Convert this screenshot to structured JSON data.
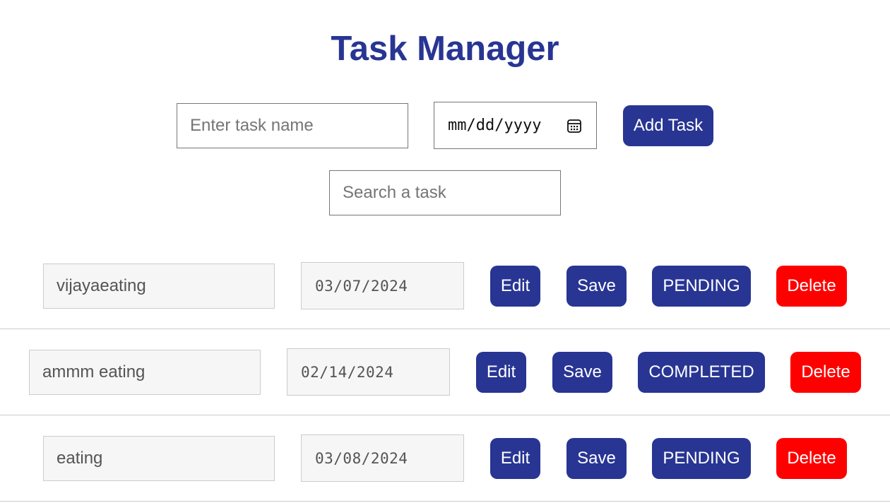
{
  "header": {
    "title": "Task Manager"
  },
  "new_task": {
    "name_placeholder": "Enter task name",
    "date_placeholder": "mm/dd/yyyy",
    "date_icon": "calendar-icon",
    "add_label": "Add Task"
  },
  "search": {
    "placeholder": "Search a task"
  },
  "colors": {
    "primary": "#283593",
    "danger": "#ff0000",
    "readonly_bg": "#f6f6f6"
  },
  "tasks": [
    {
      "name": "vijayaeating",
      "date": "03/07/2024",
      "edit_label": "Edit",
      "save_label": "Save",
      "status_label": "PENDING",
      "delete_label": "Delete"
    },
    {
      "name": "ammm eating",
      "date": "02/14/2024",
      "edit_label": "Edit",
      "save_label": "Save",
      "status_label": "COMPLETED",
      "delete_label": "Delete"
    },
    {
      "name": "eating",
      "date": "03/08/2024",
      "edit_label": "Edit",
      "save_label": "Save",
      "status_label": "PENDING",
      "delete_label": "Delete"
    }
  ]
}
